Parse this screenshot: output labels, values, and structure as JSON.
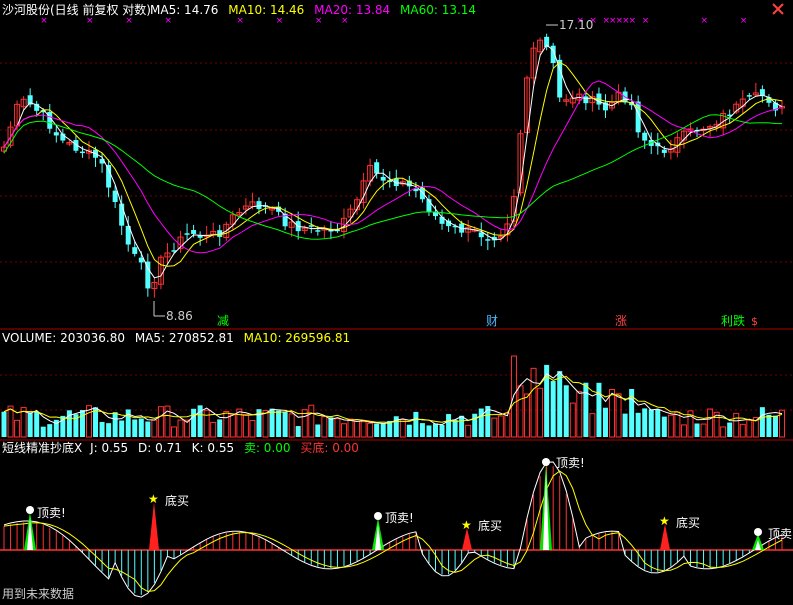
{
  "price_panel": {
    "title": "沙河股份(日线 前复权 对数)",
    "ma5": {
      "label": "MA5: 14.76",
      "color": "#ffffff"
    },
    "ma10": {
      "label": "MA10: 14.46",
      "color": "#ffff00"
    },
    "ma20": {
      "label": "MA20: 13.84",
      "color": "#ff00ff"
    },
    "ma60": {
      "label": "MA60: 13.14",
      "color": "#00ff00"
    },
    "high_label": "17.10",
    "low_label": "8.86",
    "markers": [
      {
        "text": "减",
        "color": "#00ff00"
      },
      {
        "text": "财",
        "color": "#4db8ff"
      },
      {
        "text": "涨",
        "color": "#ff4444"
      },
      {
        "text": "利跌",
        "color": "#00ff00"
      }
    ],
    "extra_marker": "$"
  },
  "volume_panel": {
    "vol": {
      "label": "VOLUME: 203036.80",
      "color": "#ffffff"
    },
    "ma5": {
      "label": "MA5: 270852.81",
      "color": "#ffffff"
    },
    "ma10": {
      "label": "MA10: 269596.81",
      "color": "#ffff00"
    }
  },
  "indicator_panel": {
    "title": "短线精准抄底X",
    "j": "J: 0.55",
    "d": "D: 0.71",
    "k": "K: 0.55",
    "sell": "卖: 0.00",
    "buy_bottom": "买底: 0.00",
    "signal_sell": "顶卖!",
    "signal_buy": "底买"
  },
  "footer": {
    "text": "用到未来数据"
  },
  "icons": {
    "close": "close-icon"
  },
  "colors": {
    "up": "#ff3232",
    "down": "#54ffff",
    "grid": "#7a0000",
    "axis": "#b00000"
  }
}
